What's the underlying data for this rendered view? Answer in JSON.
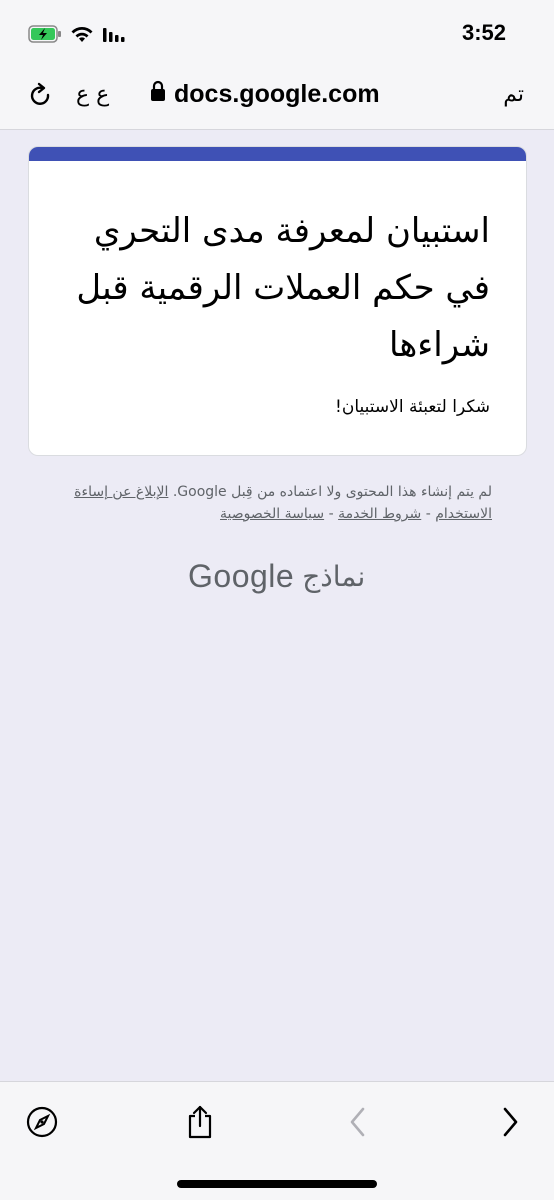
{
  "status_bar": {
    "time": "3:52",
    "icons": [
      "battery-charging-icon",
      "wifi-icon",
      "cellular-signal-icon"
    ]
  },
  "address_bar": {
    "done_label": "تم",
    "url": "docs.google.com",
    "text_size_label": "ع ع",
    "icons": [
      "lock-icon",
      "reload-icon"
    ]
  },
  "form": {
    "accent_color": "#3f51b5",
    "title": "استبيان لمعرفة مدى التحري في حكم العملات الرقمية قبل شراءها",
    "description": "شكرا لتعبئة الاستبيان!"
  },
  "footer": {
    "disclaimer": "لم يتم إنشاء هذا المحتوى ولا اعتماده من قِبل Google.",
    "report_link": "الإبلاغ عن إساءة الاستخدام",
    "terms_link": "شروط الخدمة",
    "privacy_link": "سياسة الخصوصية",
    "separator": "-"
  },
  "branding": {
    "google": "Google",
    "forms": "نماذج"
  },
  "toolbar": {
    "icons": [
      "compass-icon",
      "share-icon",
      "back-icon",
      "forward-icon"
    ]
  }
}
